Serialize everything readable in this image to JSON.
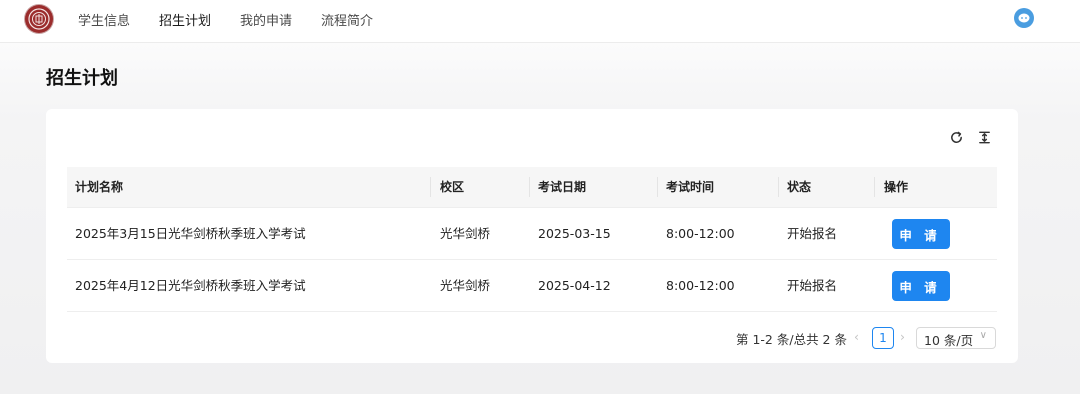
{
  "nav": {
    "items": [
      {
        "label": "学生信息"
      },
      {
        "label": "招生计划",
        "active": true
      },
      {
        "label": "我的申请"
      },
      {
        "label": "流程简介"
      }
    ]
  },
  "page": {
    "title": "招生计划"
  },
  "table": {
    "columns": [
      "计划名称",
      "校区",
      "考试日期",
      "考试时间",
      "状态",
      "操作"
    ],
    "rows": [
      {
        "name": "2025年3月15日光华剑桥秋季班入学考试",
        "campus": "光华剑桥",
        "date": "2025-03-15",
        "time": "8:00-12:00",
        "status": "开始报名",
        "action": "申 请"
      },
      {
        "name": "2025年4月12日光华剑桥秋季班入学考试",
        "campus": "光华剑桥",
        "date": "2025-04-12",
        "time": "8:00-12:00",
        "status": "开始报名",
        "action": "申 请"
      }
    ]
  },
  "pagination": {
    "total_text": "第 1-2 条/总共 2 条",
    "prev": "‹",
    "current_page": "1",
    "next": "›",
    "page_size": "10 条/页",
    "caret": "∨"
  },
  "colors": {
    "primary": "#1e86f0",
    "logo": "#9b2c2c",
    "avatar": "#4a9de0"
  },
  "icons": [
    "logo-emblem",
    "user-avatar-icon",
    "refresh-icon",
    "column-height-icon"
  ]
}
